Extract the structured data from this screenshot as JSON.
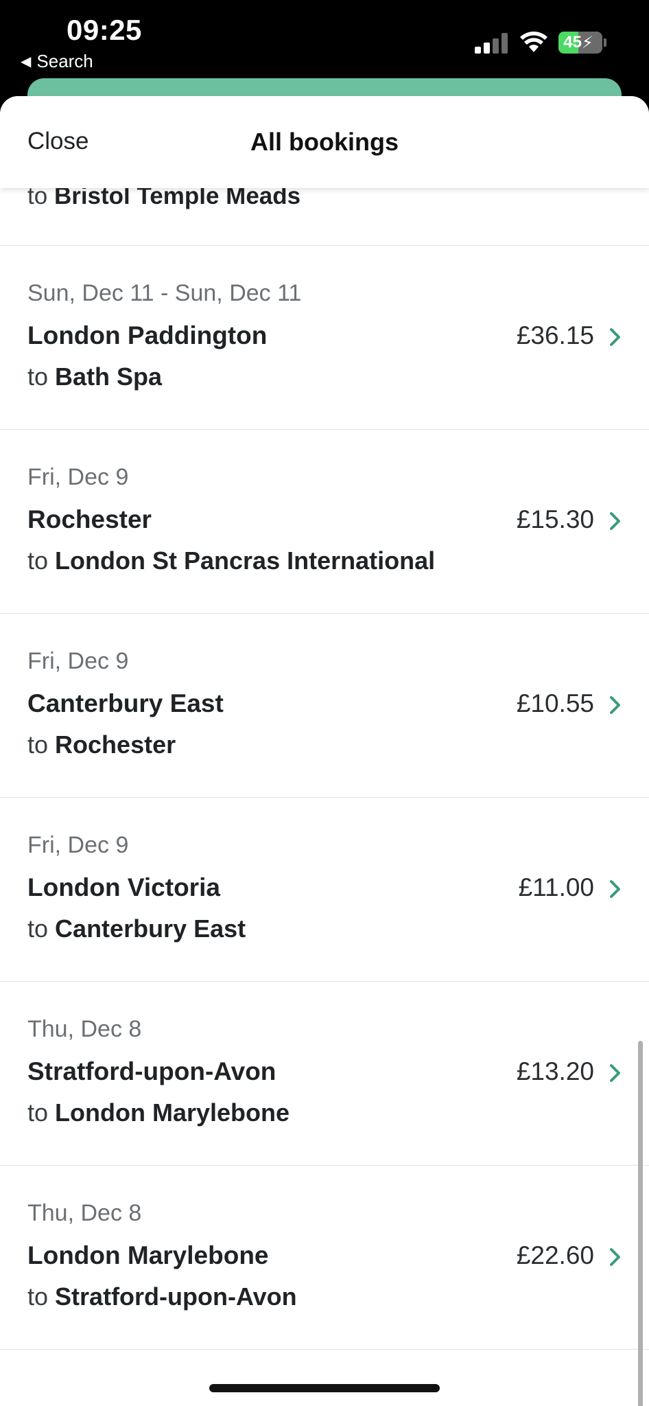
{
  "status_bar": {
    "time": "09:25",
    "back_label": "Search",
    "battery_level": "45",
    "signal_icon": "cellular-signal-icon",
    "wifi_icon": "wifi-icon",
    "battery_icon": "battery-charging-icon"
  },
  "header": {
    "close_label": "Close",
    "title": "All bookings"
  },
  "partial_booking": {
    "to_label": "to",
    "destination": "Bristol Temple Meads"
  },
  "bookings": [
    {
      "date": "Sun, Dec 11 - Sun, Dec 11",
      "origin": "London Paddington",
      "to_label": "to",
      "destination": "Bath Spa",
      "price": "£36.15"
    },
    {
      "date": "Fri, Dec 9",
      "origin": "Rochester",
      "to_label": "to",
      "destination": "London St Pancras International",
      "price": "£15.30"
    },
    {
      "date": "Fri, Dec 9",
      "origin": "Canterbury East",
      "to_label": "to",
      "destination": "Rochester",
      "price": "£10.55"
    },
    {
      "date": "Fri, Dec 9",
      "origin": "London Victoria",
      "to_label": "to",
      "destination": "Canterbury East",
      "price": "£11.00"
    },
    {
      "date": "Thu, Dec 8",
      "origin": "Stratford-upon-Avon",
      "to_label": "to",
      "destination": "London Marylebone",
      "price": "£13.20"
    },
    {
      "date": "Thu, Dec 8",
      "origin": "London Marylebone",
      "to_label": "to",
      "destination": "Stratford-upon-Avon",
      "price": "£22.60"
    }
  ],
  "colors": {
    "accent": "#3a9b7c",
    "behind_card": "#6cbf9f",
    "battery_fill": "#4cd964"
  }
}
